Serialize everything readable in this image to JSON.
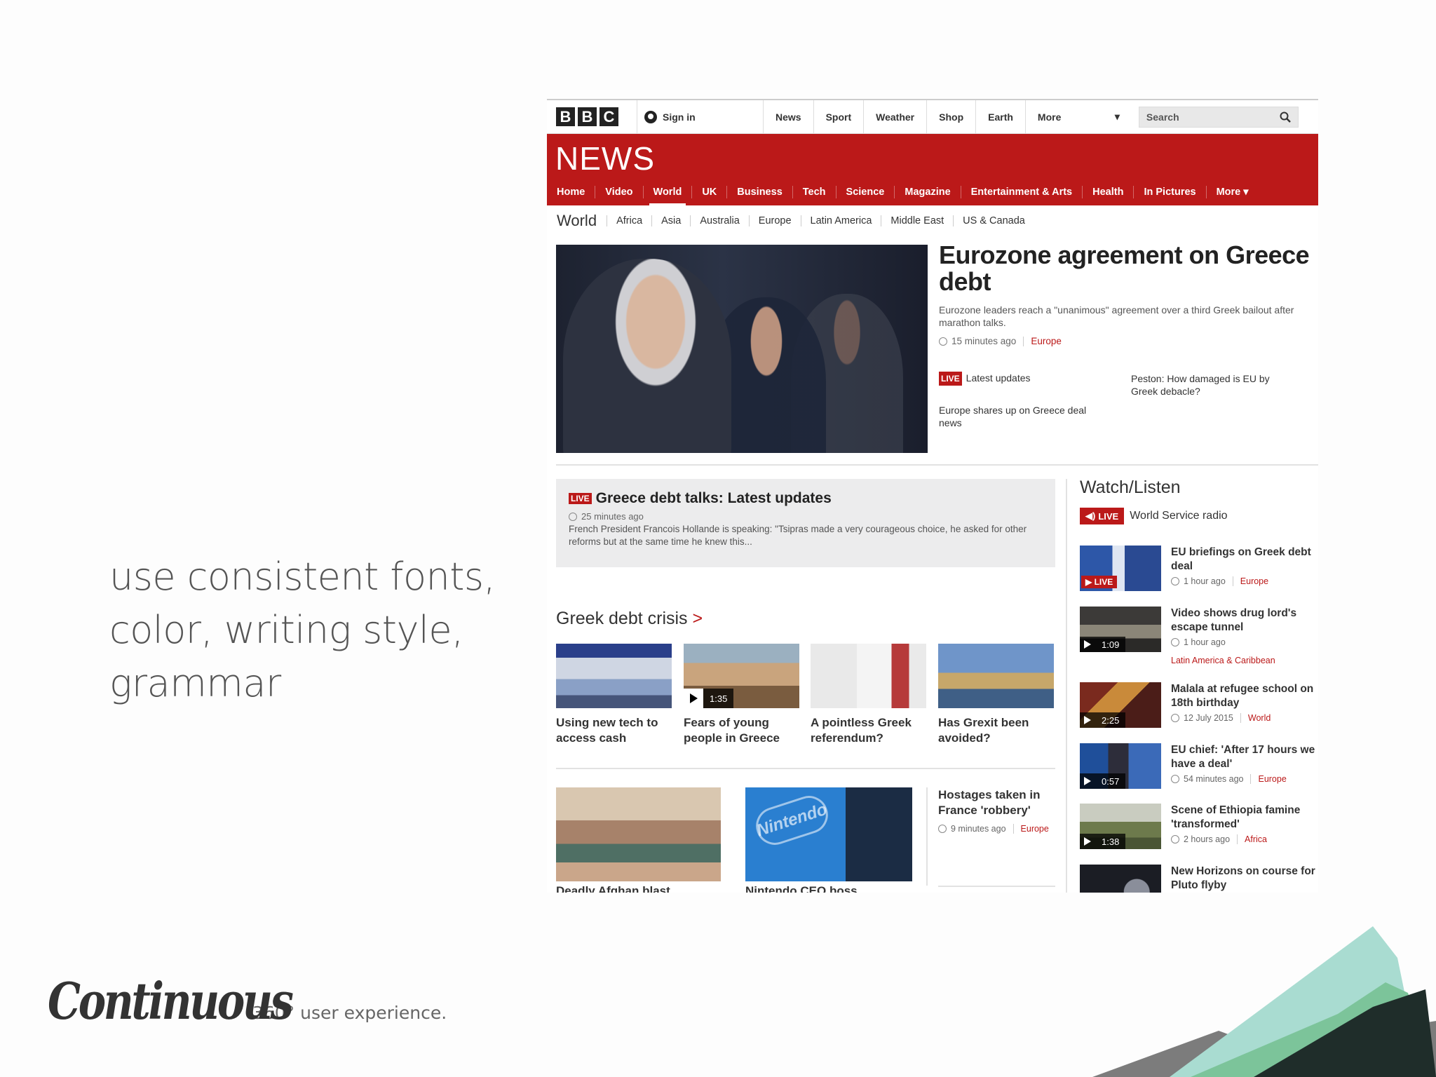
{
  "slide": {
    "caption_lines": [
      "use consistent fonts,",
      "color, writing style,",
      "grammar"
    ],
    "brand": "Continuous",
    "tagline": "360° user experience."
  },
  "topbar": {
    "logo_letters": [
      "B",
      "B",
      "C"
    ],
    "signin": "Sign in",
    "nav": [
      "News",
      "Sport",
      "Weather",
      "Shop",
      "Earth",
      "More"
    ],
    "search_placeholder": "Search"
  },
  "newsbar": {
    "title": "NEWS",
    "nav": [
      "Home",
      "Video",
      "World",
      "UK",
      "Business",
      "Tech",
      "Science",
      "Magazine",
      "Entertainment & Arts",
      "Health",
      "In Pictures",
      "More ▾"
    ],
    "active": "World"
  },
  "subnav": {
    "title": "World",
    "items": [
      "Africa",
      "Asia",
      "Australia",
      "Europe",
      "Latin America",
      "Middle East",
      "US & Canada"
    ]
  },
  "lead": {
    "headline": "Eurozone agreement on Greece debt",
    "summary": "Eurozone leaders reach a \"unanimous\" agreement over a third Greek bailout after marathon talks.",
    "time": "15 minutes ago",
    "tag": "Europe",
    "related": [
      {
        "badge": "LIVE",
        "text": "Latest updates"
      },
      {
        "text": "Peston: How damaged is EU by Greek debacle?"
      },
      {
        "text": "Europe shares up on Greece deal news"
      }
    ]
  },
  "livebox": {
    "badge": "LIVE",
    "title": "Greece debt talks: Latest updates",
    "time": "25 minutes ago",
    "text": "French President Francois Hollande is speaking: \"Tsipras made a very courageous choice, he asked for other reforms but at the same time he knew this..."
  },
  "greek_section": {
    "title": "Greek debt crisis",
    "chevron": ">",
    "tiles": [
      {
        "caption": "Using new tech to access cash"
      },
      {
        "caption": "Fears of young people in Greece",
        "duration": "1:35"
      },
      {
        "caption": "A pointless Greek referendum?"
      },
      {
        "caption": "Has Grexit been avoided?"
      }
    ]
  },
  "bottom": {
    "story": {
      "caption": "Hostages taken in France 'robbery'",
      "time": "9 minutes ago",
      "tag": "Europe"
    },
    "cut_captions": [
      "Deadly Afghan blast",
      "Nintendo CEO boss"
    ],
    "logo_text": "Nintendo"
  },
  "watch": {
    "title": "Watch/Listen",
    "radio_badge": "LIVE",
    "radio_label": "World Service radio",
    "items": [
      {
        "caption": "EU briefings on Greek debt deal",
        "time": "1 hour ago",
        "tag": "Europe",
        "live": "LIVE"
      },
      {
        "caption": "Video shows drug lord's escape tunnel",
        "time": "1 hour ago",
        "tag": "Latin America & Caribbean",
        "duration": "1:09"
      },
      {
        "caption": "Malala at refugee school on 18th birthday",
        "time": "12 July 2015",
        "tag": "World",
        "duration": "2:25"
      },
      {
        "caption": "EU chief: 'After 17 hours we have a deal'",
        "time": "54 minutes ago",
        "tag": "Europe",
        "duration": "0:57"
      },
      {
        "caption": "Scene of Ethiopia famine 'transformed'",
        "time": "2 hours ago",
        "tag": "Africa",
        "duration": "1:38"
      },
      {
        "caption": "New Horizons on course for Pluto flyby"
      }
    ]
  }
}
